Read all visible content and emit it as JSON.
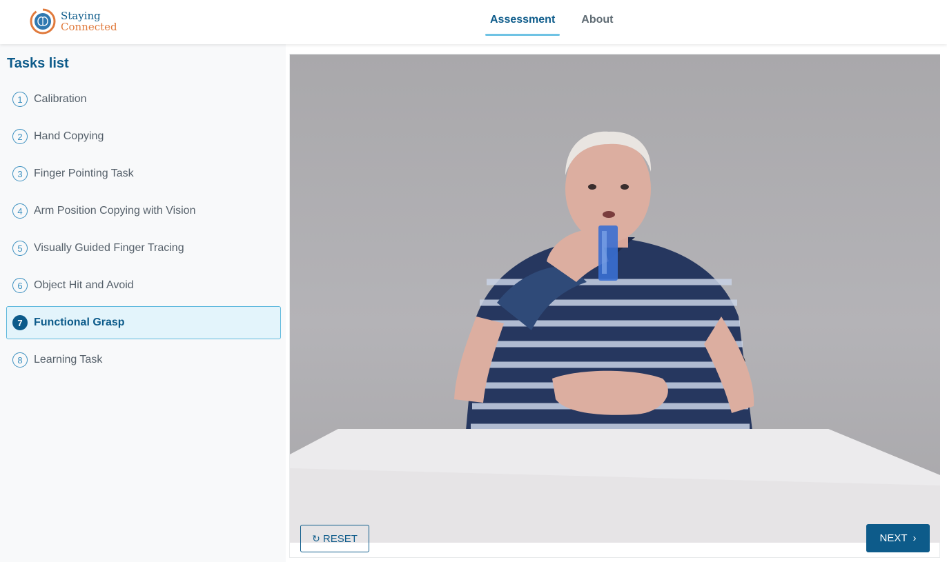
{
  "app": {
    "logo": {
      "line1": "Staying",
      "line2": "Connected",
      "icon": "brain-logo-icon"
    }
  },
  "nav": {
    "tabs": [
      {
        "label": "Assessment",
        "active": true
      },
      {
        "label": "About",
        "active": false
      }
    ]
  },
  "sidebar": {
    "title": "Tasks list",
    "tasks": [
      {
        "num": "1",
        "label": "Calibration"
      },
      {
        "num": "2",
        "label": "Hand Copying"
      },
      {
        "num": "3",
        "label": "Finger Pointing Task"
      },
      {
        "num": "4",
        "label": "Arm Position Copying with Vision"
      },
      {
        "num": "5",
        "label": "Visually Guided Finger Tracing"
      },
      {
        "num": "6",
        "label": "Object Hit and Avoid"
      },
      {
        "num": "7",
        "label": "Functional Grasp",
        "active": true
      },
      {
        "num": "8",
        "label": "Learning Task"
      }
    ]
  },
  "main": {
    "video": {
      "content": "person-drinking-from-cup"
    },
    "reset_label": "RESET",
    "reset_icon": "refresh-icon",
    "next_label": "NEXT",
    "next_icon": "chevron-right-icon"
  },
  "colors": {
    "primary": "#0d5b8a",
    "accent": "#6fc3e4",
    "logo_orange": "#e07a3c",
    "active_bg": "#e3f4fb"
  }
}
